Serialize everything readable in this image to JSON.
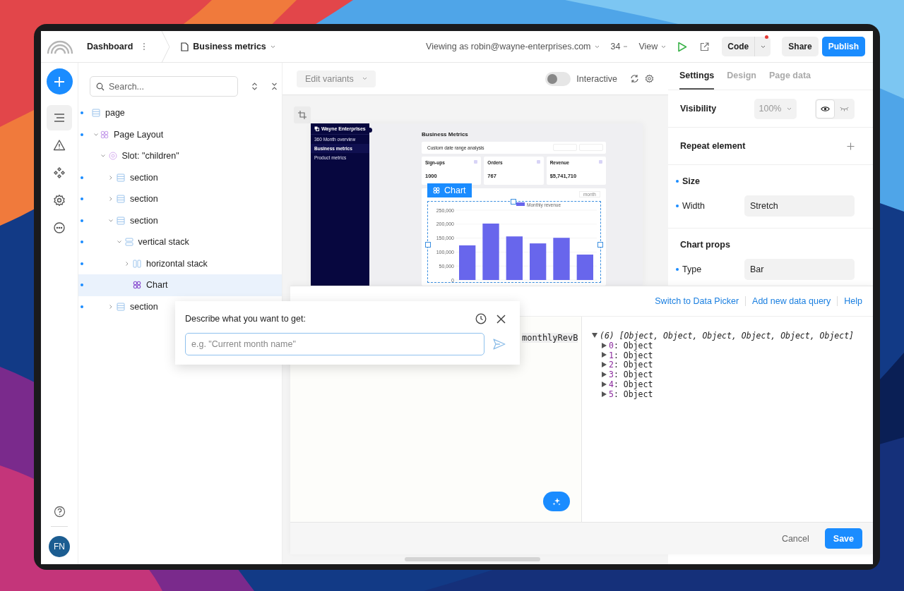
{
  "topbar": {
    "app": "Dashboard",
    "page": "Business metrics",
    "viewing_as": "Viewing as robin@wayne-enterprises.com",
    "zoom": "34",
    "view": "View",
    "code": {
      "label": "Code",
      "notification": true
    },
    "share": "Share",
    "publish": "Publish"
  },
  "rail": {
    "items": [
      {
        "kind": "layers",
        "selected": true
      },
      {
        "kind": "warning",
        "selected": false
      },
      {
        "kind": "components",
        "selected": false
      },
      {
        "kind": "settings",
        "selected": false
      },
      {
        "kind": "more",
        "selected": false
      }
    ],
    "avatar": "FN"
  },
  "tree": {
    "search_placeholder": "Search...",
    "nodes": [
      {
        "label": "page",
        "kind": "section",
        "bound": true,
        "selected": false
      },
      {
        "label": "Page Layout",
        "kind": "component",
        "bound": true,
        "selected": false,
        "expanded": true,
        "children": [
          {
            "label": "Slot: \"children\"",
            "kind": "slot",
            "bound": false,
            "selected": false,
            "expanded": true,
            "children": [
              {
                "label": "section",
                "kind": "section",
                "bound": true,
                "selected": false,
                "expanded": false
              },
              {
                "label": "section",
                "kind": "section",
                "bound": true,
                "selected": false,
                "expanded": false
              },
              {
                "label": "section",
                "kind": "section",
                "bound": true,
                "selected": false,
                "expanded": true,
                "children": [
                  {
                    "label": "vertical stack",
                    "kind": "vstack",
                    "bound": true,
                    "selected": false,
                    "expanded": true,
                    "children": [
                      {
                        "label": "horizontal stack",
                        "kind": "hstack",
                        "bound": true,
                        "selected": false,
                        "expanded": false
                      },
                      {
                        "label": "Chart",
                        "kind": "component",
                        "bound": true,
                        "selected": true
                      }
                    ]
                  }
                ]
              },
              {
                "label": "section",
                "kind": "section",
                "bound": true,
                "selected": false,
                "expanded": false
              }
            ]
          }
        ]
      }
    ]
  },
  "canvas": {
    "variants": "Edit variants",
    "interactive": {
      "label": "Interactive",
      "on": false
    },
    "preview": {
      "brand": "Wayne Enterprises",
      "nav": [
        {
          "label": "360 Month overview",
          "selected": false
        },
        {
          "label": "Business metrics",
          "selected": true
        },
        {
          "label": "Product metrics",
          "selected": false
        }
      ],
      "title": "Business Metrics",
      "filter": "Custom date range analysis",
      "kpis": [
        {
          "label": "Sign-ups",
          "value": "1000"
        },
        {
          "label": "Orders",
          "value": "767"
        },
        {
          "label": "Revenue",
          "value": "$5,741,710"
        }
      ],
      "chart": {
        "badge": "Chart",
        "period": "month",
        "chart_data": {
          "type": "bar",
          "grid": true,
          "ylim": [
            0,
            250000
          ],
          "yticks": [
            {
              "value": 0,
              "label": "0"
            },
            {
              "value": 50000,
              "label": "50,000"
            },
            {
              "value": 100000,
              "label": "100,000"
            },
            {
              "value": 150000,
              "label": "150,000"
            },
            {
              "value": 200000,
              "label": "200,000"
            },
            {
              "value": 250000,
              "label": "250,000"
            }
          ],
          "series": [
            {
              "name": "Monthly revenue",
              "color": "#6866ec",
              "values": [
                124000,
                202000,
                156000,
                131000,
                151000,
                91000
              ]
            }
          ]
        }
      }
    }
  },
  "inspector": {
    "tabs": [
      {
        "label": "Settings",
        "selected": true
      },
      {
        "label": "Design",
        "selected": false
      },
      {
        "label": "Page data",
        "selected": false
      }
    ],
    "visibility": {
      "label": "Visibility",
      "opacity": "100%",
      "visible": true
    },
    "repeat": {
      "label": "Repeat element"
    },
    "size": {
      "title": "Size",
      "bound": true,
      "width_label": "Width",
      "width_bound": true,
      "width": "Stretch"
    },
    "chart_props": {
      "title": "Chart props",
      "type_label": "Type",
      "type_bound": true,
      "type": "Bar"
    }
  },
  "edit_code": {
    "links": [
      "Switch to Data Picker",
      "Add new data query",
      "Help"
    ],
    "code": "monthlyRevB",
    "output": {
      "summary": "(6) [Object, Object, Object, Object, Object, Object]",
      "expanded": true,
      "items": [
        {
          "index": "0",
          "value": ": Object",
          "expanded": false
        },
        {
          "index": "1",
          "value": ": Object",
          "expanded": false
        },
        {
          "index": "2",
          "value": ": Object",
          "expanded": false
        },
        {
          "index": "3",
          "value": ": Object",
          "expanded": false
        },
        {
          "index": "4",
          "value": ": Object",
          "expanded": false
        },
        {
          "index": "5",
          "value": ": Object",
          "expanded": false
        }
      ]
    },
    "cancel": "Cancel",
    "save": "Save"
  },
  "prompt": {
    "title": "Describe what you want to get:",
    "placeholder": "e.g. \"Current month name\""
  }
}
